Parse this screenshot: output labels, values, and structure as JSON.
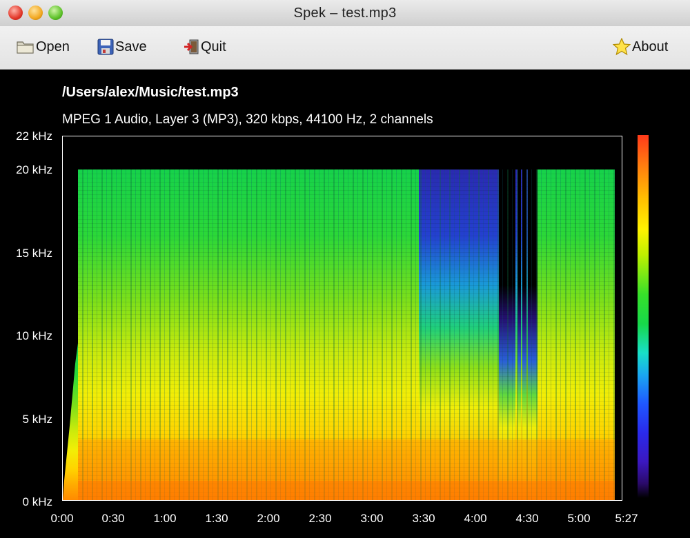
{
  "window": {
    "title": "Spek – test.mp3"
  },
  "toolbar": {
    "open_label": "Open",
    "save_label": "Save",
    "quit_label": "Quit",
    "about_label": "About"
  },
  "file": {
    "path": "/Users/alex/Music/test.mp3",
    "info": "MPEG 1 Audio, Layer 3 (MP3), 320 kbps, 44100 Hz, 2 channels"
  },
  "axes": {
    "y_ticks": [
      "22 kHz",
      "20 kHz",
      "15 kHz",
      "10 kHz",
      "5 kHz",
      "0 kHz"
    ],
    "x_ticks": [
      "0:00",
      "0:30",
      "1:00",
      "1:30",
      "2:00",
      "2:30",
      "3:00",
      "3:30",
      "4:00",
      "4:30",
      "5:00",
      "5:27"
    ]
  },
  "chart_data": {
    "type": "heatmap",
    "y_ticks_khz": [
      0,
      5,
      10,
      15,
      20,
      22
    ],
    "ylim_khz": [
      0,
      22
    ],
    "x_ticks_seconds": [
      0,
      30,
      60,
      90,
      120,
      150,
      180,
      210,
      240,
      270,
      300,
      327
    ],
    "xlim_seconds": [
      0,
      327
    ],
    "content_cutoff_khz": 20,
    "colormap": [
      "#000000",
      "#2a0a6a",
      "#2a2aeb",
      "#1aa8f0",
      "#18e0c8",
      "#36e02a",
      "#fff200",
      "#ffc200",
      "#ff7a10",
      "#ff3a1a"
    ]
  },
  "colors": {
    "background": "#000000",
    "text": "#ffffff",
    "toolbar": "#e8e8e8"
  }
}
